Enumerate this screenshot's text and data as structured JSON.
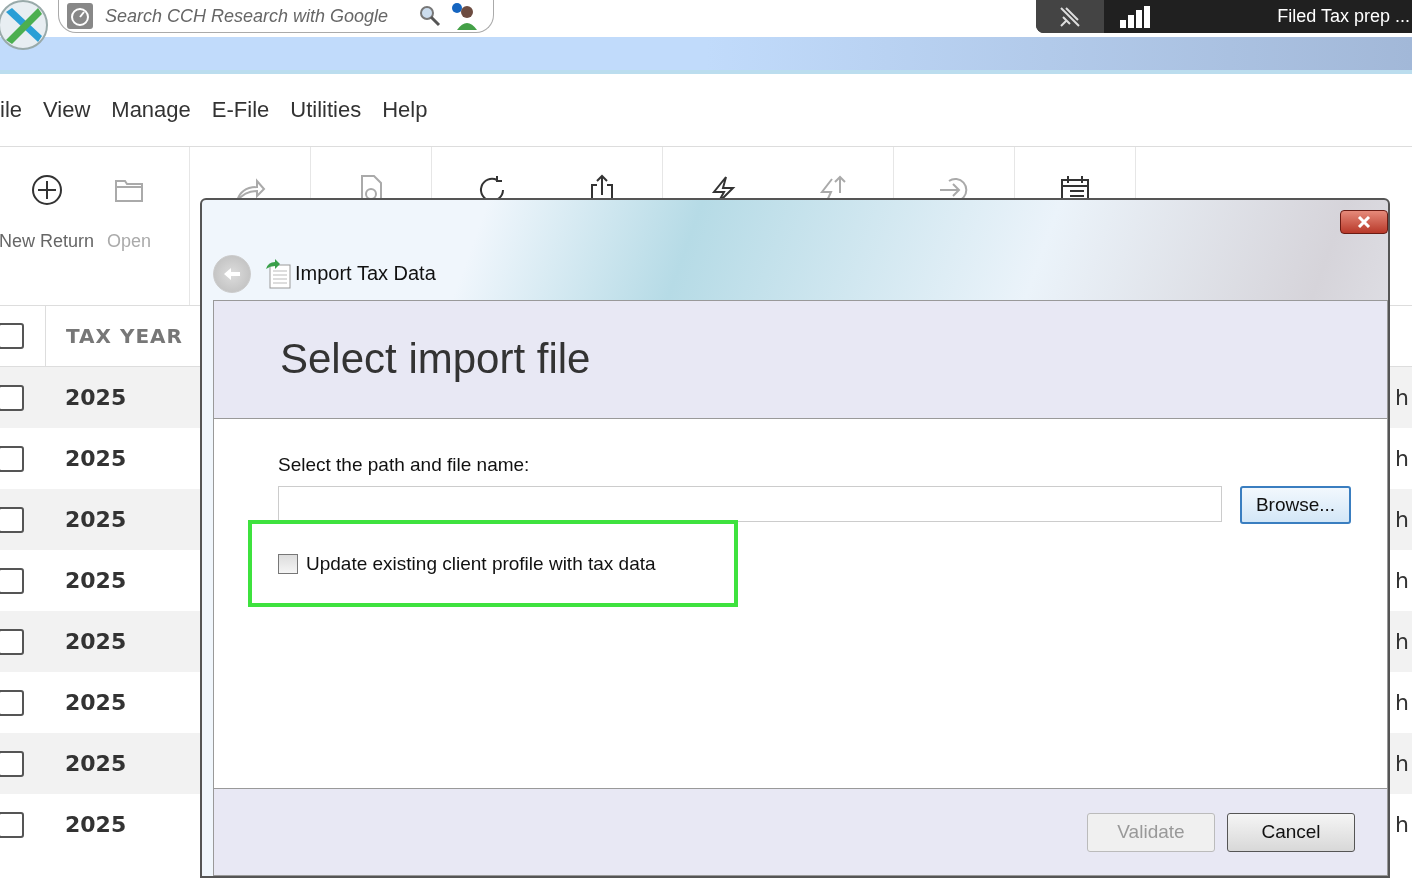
{
  "search": {
    "placeholder": "Search CCH Research with Google"
  },
  "taskbar_popup": {
    "title": "Filed Tax prep ..."
  },
  "menu": [
    "ile",
    "View",
    "Manage",
    "E-File",
    "Utilities",
    "Help"
  ],
  "toolbar": {
    "groups": [
      [
        {
          "label": "New Return",
          "disabled": false
        },
        {
          "label": "Open",
          "disabled": true
        }
      ],
      [
        {
          "disabled": true
        }
      ],
      [
        {
          "disabled": true
        }
      ],
      [
        {
          "disabled": false
        },
        {
          "disabled": false
        }
      ],
      [
        {
          "disabled": false
        },
        {
          "disabled": true
        }
      ],
      [
        {
          "disabled": true
        }
      ],
      [
        {
          "disabled": false
        }
      ]
    ]
  },
  "grid": {
    "columns": [
      "TAX YEAR"
    ],
    "header_checked": false,
    "rows": [
      {
        "checked": false,
        "tax_year": "2025",
        "column_2": "h"
      },
      {
        "checked": false,
        "tax_year": "2025",
        "column_2": "h"
      },
      {
        "checked": false,
        "tax_year": "2025",
        "column_2": "h"
      },
      {
        "checked": false,
        "tax_year": "2025",
        "column_2": "h"
      },
      {
        "checked": false,
        "tax_year": "2025",
        "column_2": "h"
      },
      {
        "checked": false,
        "tax_year": "2025",
        "column_2": "h"
      },
      {
        "checked": false,
        "tax_year": "2025",
        "column_2": "h"
      },
      {
        "checked": false,
        "tax_year": "2025",
        "column_2": "h"
      }
    ]
  },
  "dialog": {
    "title": "Import Tax Data",
    "heading": "Select import file",
    "path_label": "Select the path and file name:",
    "browse": "Browse...",
    "update_option": {
      "label": "Update existing client profile with tax data",
      "checked": false,
      "highlighted": true
    },
    "buttons": [
      {
        "label": "Validate",
        "disabled": true
      },
      {
        "label": "Cancel",
        "disabled": false
      }
    ]
  }
}
